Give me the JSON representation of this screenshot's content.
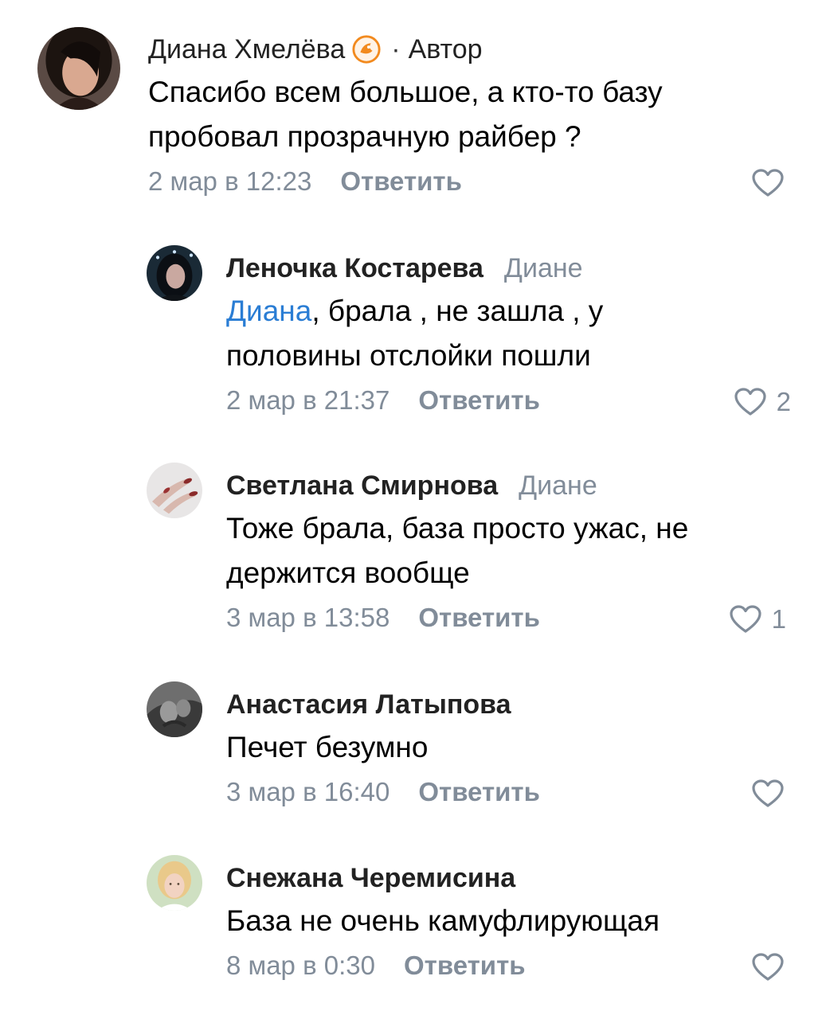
{
  "reply_label": "Ответить",
  "comments": [
    {
      "author": "Диана Хмелёва",
      "separator": "·",
      "tag": "Автор",
      "reply_to": "",
      "mention": "",
      "text": "Спасибо всем большое, а кто-то базу пробовал прозрачную райбер ?",
      "date": "2 мар в 12:23",
      "likes": ""
    },
    {
      "author": "Леночка Костарева",
      "reply_to": "Диане",
      "mention": "Диана",
      "text": ", брала , не зашла , у половины отслойки пошли",
      "date": "2 мар в 21:37",
      "likes": "2"
    },
    {
      "author": "Светлана Смирнова",
      "reply_to": "Диане",
      "mention": "",
      "text": "Тоже брала, база просто ужас, не держится вообще",
      "date": "3 мар в 13:58",
      "likes": "1"
    },
    {
      "author": "Анастасия Латыпова",
      "reply_to": "",
      "mention": "",
      "text": "Печет безумно",
      "date": "3 мар в 16:40",
      "likes": ""
    },
    {
      "author": "Снежана Черемисина",
      "reply_to": "",
      "mention": "",
      "text": "База не очень камуфлирующая",
      "date": "8 мар в 0:30",
      "likes": ""
    }
  ],
  "colors": {
    "accent_link": "#2a7dd4",
    "secondary_text": "#818c99"
  },
  "icons": {
    "like": "heart-outline-icon",
    "badge": "author-badge-icon"
  }
}
